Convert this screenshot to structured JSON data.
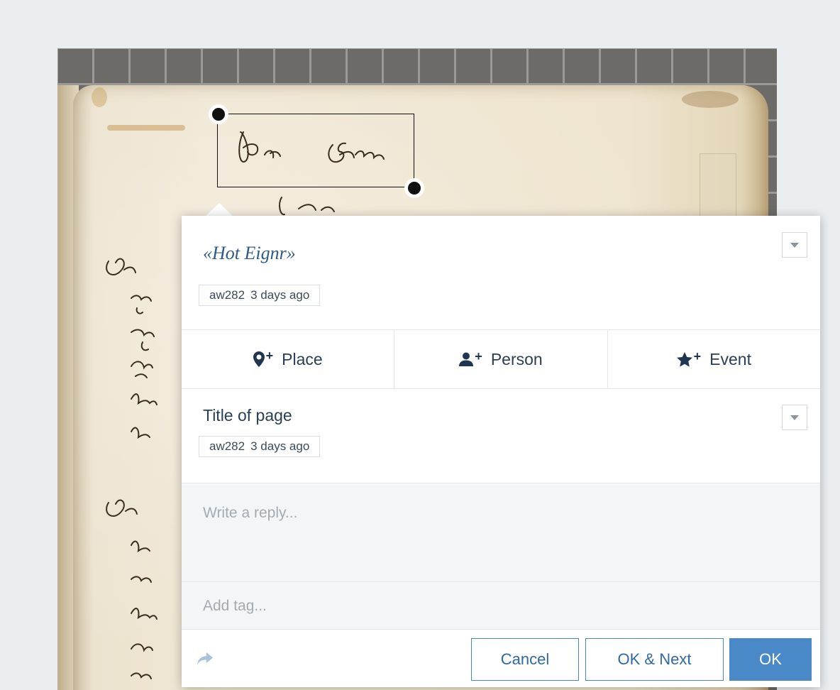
{
  "annotation": {
    "quote": "«Hot Eignr»",
    "quote_meta": {
      "user": "aw282",
      "time": "3 days ago"
    }
  },
  "tag_buttons": [
    {
      "label": "Place",
      "icon": "map-marker-icon",
      "plus": "+"
    },
    {
      "label": "Person",
      "icon": "user-icon",
      "plus": "+"
    },
    {
      "label": "Event",
      "icon": "star-icon",
      "plus": "+"
    }
  ],
  "comment": {
    "text": "Title of page",
    "meta": {
      "user": "aw282",
      "time": "3 days ago"
    }
  },
  "reply": {
    "placeholder": "Write a reply..."
  },
  "tag_input": {
    "placeholder": "Add tag..."
  },
  "footer": {
    "share_icon": "share-arrow-icon",
    "cancel_label": "Cancel",
    "next_label": "OK & Next",
    "ok_label": "OK"
  },
  "colors": {
    "accent": "#4a89c8",
    "quote": "#2d5a8a",
    "background": "#ebeef0"
  }
}
